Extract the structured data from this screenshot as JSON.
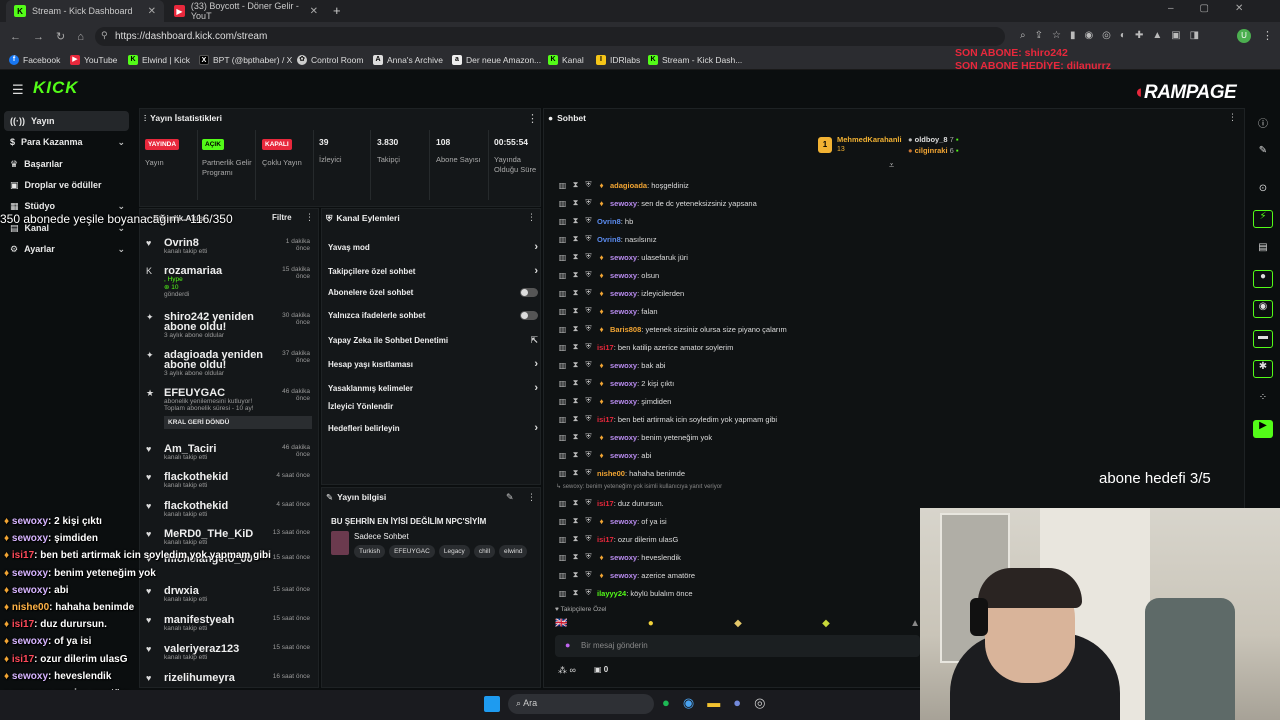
{
  "tabs": [
    {
      "title": "Stream - Kick Dashboard",
      "active": true
    },
    {
      "title": "(33) Boycott - Döner Gelir - YouT",
      "active": false
    }
  ],
  "browser": {
    "url": "https://dashboard.kick.com/stream"
  },
  "bookmarks": [
    "Facebook",
    "YouTube",
    "Elwind | Kick",
    "BPT (@bpthaber) / X",
    "Control Room",
    "Anna's Archive",
    "Der neue Amazon...",
    "Kanal",
    "IDRlabs",
    "Stream - Kick Dash..."
  ],
  "overlay": {
    "son_abone": "SON ABONE: shiro242",
    "son_abone_hediye": "SON ABONE HEDİYE: dilanurrz",
    "brand": "RAMPAGE",
    "sub_goal_text": "350 abonede yeşile boyanacağım - 116/350",
    "abone_hedefi": "abone hedefi 3/5"
  },
  "sidebar": {
    "logo": "KICK",
    "items": [
      {
        "label": "Yayın",
        "active": true
      },
      {
        "label": "Para Kazanma",
        "chevron": true
      },
      {
        "label": "Başarılar"
      },
      {
        "label": "Droplar ve ödüller"
      },
      {
        "label": "Stüdyo",
        "chevron": true
      },
      {
        "label": "Kanal",
        "chevron": true
      },
      {
        "label": "Ayarlar",
        "chevron": true
      }
    ]
  },
  "stats": {
    "title": "Yayın İstatistikleri",
    "badges": [
      {
        "badge": "YAYINDA",
        "label": "Yayın",
        "color": "#e8283c"
      },
      {
        "badge": "AÇIK",
        "label": "Partnerlik Gelir Programı",
        "color": "#53fc18"
      },
      {
        "badge": "KAPALI",
        "label": "Çoklu Yayın",
        "color": "#e8283c"
      }
    ],
    "numbers": [
      {
        "value": "39",
        "label": "İzleyici"
      },
      {
        "value": "3.830",
        "label": "Takipçi"
      },
      {
        "value": "108",
        "label": "Abone Sayısı"
      },
      {
        "value": "00:55:54",
        "label": "Yayında Olduğu Süre"
      }
    ]
  },
  "activity": {
    "title": "Etkinlik Akışı",
    "filter": "Filtre",
    "items": [
      {
        "name": "Ovrin8",
        "sub": "kanalı takip etti",
        "time": "1 dakika önce",
        "icon": "♥"
      },
      {
        "name": "rozamariaa",
        "sub": ", Hype",
        "sub2": "10",
        "sub3": "gönderdi",
        "time": "15 dakika önce",
        "icon": "K"
      },
      {
        "name": "shiro242 yeniden abone oldu!",
        "sub": "3 aylık abone oldular",
        "time": "30 dakika önce",
        "icon": "✦"
      },
      {
        "name": "adagioada yeniden abone oldu!",
        "sub": "3 aylık abone oldular",
        "time": "37 dakika önce",
        "icon": "✦"
      },
      {
        "name": "EFEUYGAC",
        "sub": "abonelik yenilemesini kutluyor! Toplam abonelik süresi - 10 ay!",
        "box": "KRAL GERİ DÖNDÜ",
        "time": "46 dakika önce",
        "icon": "★"
      },
      {
        "name": "Am_Taciri",
        "sub": "kanalı takip etti",
        "time": "46 dakika önce",
        "icon": "♥"
      },
      {
        "name": "flackothekid",
        "sub": "kanalı takip etti",
        "time": "4 saat önce",
        "icon": "♥"
      },
      {
        "name": "flackothekid",
        "sub": "kanalı takip etti",
        "time": "4 saat önce",
        "icon": "♥"
      },
      {
        "name": "MeRD0_THe_KiD",
        "sub": "kanalı takip etti",
        "time": "13 saat önce",
        "icon": "♥"
      },
      {
        "name": "michelangelo_00",
        "sub": "",
        "time": "15 saat önce",
        "icon": "♥"
      },
      {
        "name": "drwxia",
        "sub": "kanalı takip etti",
        "time": "15 saat önce",
        "icon": "♥"
      },
      {
        "name": "manifestyeah",
        "sub": "kanalı takip etti",
        "time": "15 saat önce",
        "icon": "♥"
      },
      {
        "name": "valeriyeraz123",
        "sub": "kanalı takip etti",
        "time": "15 saat önce",
        "icon": "♥"
      },
      {
        "name": "rizelihumeyra",
        "sub": "",
        "time": "16 saat önce",
        "icon": "♥"
      }
    ]
  },
  "channel_actions": {
    "title": "Kanal Eylemleri",
    "items": [
      {
        "label": "Yavaş mod",
        "ctrl": "arrow"
      },
      {
        "label": "Takipçilere özel sohbet",
        "ctrl": "arrow"
      },
      {
        "label": "Abonelere özel sohbet",
        "ctrl": "toggle"
      },
      {
        "label": "Yalnızca ifadelerle sohbet",
        "ctrl": "toggle"
      },
      {
        "label": "Yapay Zeka ile Sohbet Denetimi",
        "ctrl": "ext"
      },
      {
        "label": "Hesap yaşı kısıtlaması",
        "ctrl": "arrow"
      },
      {
        "label": "Yasaklanmış kelimeler",
        "ctrl": "arrow"
      },
      {
        "label": "İzleyici Yönlendir",
        "ctrl": "none"
      },
      {
        "label": "Hedefleri belirleyin",
        "ctrl": "arrow"
      }
    ]
  },
  "stream_info": {
    "title": "Yayın bilgisi",
    "stream_title": "BU ŞEHRİN EN İYİSİ DEĞİLİM NPC'SİYİM",
    "category": "Sadece Sohbet",
    "tags": [
      "Turkish",
      "EFEUYGAC",
      "Legacy",
      "chill",
      "elwind"
    ]
  },
  "chat": {
    "title": "Sohbet",
    "pinned": [
      {
        "name": "MehmedKarahanli",
        "count": "13"
      },
      {
        "name": "oldboy_8",
        "count": "7"
      },
      {
        "name": "cilginraki",
        "count": "6"
      }
    ],
    "messages": [
      {
        "user": "adagioada",
        "color": "#f2a533",
        "text": ": hoşgeldiniz"
      },
      {
        "user": "sewoxy",
        "color": "#b98cf0",
        "text": ": sen de dc yeteneksizsiniz yapsana"
      },
      {
        "user": "Ovrin8",
        "color": "#5b8cf0",
        "text": ": hb"
      },
      {
        "user": "Ovrin8",
        "color": "#5b8cf0",
        "text": ": nasılsınız"
      },
      {
        "user": "sewoxy",
        "color": "#b98cf0",
        "text": ": ulasefaruk jüri"
      },
      {
        "user": "sewoxy",
        "color": "#b98cf0",
        "text": ": olsun"
      },
      {
        "user": "sewoxy",
        "color": "#b98cf0",
        "text": ": izleyicilerden"
      },
      {
        "user": "sewoxy",
        "color": "#b98cf0",
        "text": ": falan"
      },
      {
        "user": "Baris808",
        "color": "#f2a533",
        "text": ": yetenek sizsiniz olursa size piyano çalarım"
      },
      {
        "user": "isi17",
        "color": "#e8283c",
        "text": ": ben katilip azerice amator soylerim"
      },
      {
        "user": "sewoxy",
        "color": "#b98cf0",
        "text": ": bak abi"
      },
      {
        "user": "sewoxy",
        "color": "#b98cf0",
        "text": ": 2 kişi çıktı"
      },
      {
        "user": "sewoxy",
        "color": "#b98cf0",
        "text": ": şimdiden"
      },
      {
        "user": "isi17",
        "color": "#e8283c",
        "text": ": ben beti artirmak icin soyledim yok yapmam gibi"
      },
      {
        "user": "sewoxy",
        "color": "#b98cf0",
        "text": ": benim yeteneğim yok"
      },
      {
        "user": "sewoxy",
        "color": "#b98cf0",
        "text": ": abi"
      },
      {
        "user": "nishe00",
        "color": "#f2a533",
        "text": ": hahaha benimde"
      },
      {
        "user": "isi17",
        "color": "#e8283c",
        "text": ": duz durursun.",
        "reply": "↳ sewoxy: benim yeteneğim yok isimli kullanıcıya yanıt veriyor"
      },
      {
        "user": "sewoxy",
        "color": "#b98cf0",
        "text": ": of ya isi"
      },
      {
        "user": "isi17",
        "color": "#e8283c",
        "text": ": ozur dilerim ulasG"
      },
      {
        "user": "sewoxy",
        "color": "#b98cf0",
        "text": ": heveslendik"
      },
      {
        "user": "sewoxy",
        "color": "#b98cf0",
        "text": ": azerice amatöre"
      },
      {
        "user": "ilayyy24",
        "color": "#53fc18",
        "text": ": köylü bulalım önce"
      }
    ],
    "mode": "Takipçilere Özel",
    "placeholder": "Bir mesaj gönderin",
    "viewers_icon": "∞",
    "count": "0"
  },
  "overlay_chat": [
    {
      "user": "sewoxy",
      "color": "#d6b4ff",
      "text": ": 2 kişi çıktı"
    },
    {
      "user": "sewoxy",
      "color": "#d6b4ff",
      "text": ": şimdiden"
    },
    {
      "user": "isi17",
      "color": "#ff4a5a",
      "text": ": ben beti artirmak icin soyledim yok yapmam gibi"
    },
    {
      "user": "sewoxy",
      "color": "#d6b4ff",
      "text": ": benim yeteneğim yok"
    },
    {
      "user": "sewoxy",
      "color": "#d6b4ff",
      "text": ": abi"
    },
    {
      "user": "nishe00",
      "color": "#ffb347",
      "text": ": hahaha benimde"
    },
    {
      "user": "isi17",
      "color": "#ff4a5a",
      "text": ": duz durursun."
    },
    {
      "user": "sewoxy",
      "color": "#d6b4ff",
      "text": ": of ya isi"
    },
    {
      "user": "isi17",
      "color": "#ff4a5a",
      "text": ": ozur dilerim ulasG"
    },
    {
      "user": "sewoxy",
      "color": "#d6b4ff",
      "text": ": heveslendik"
    },
    {
      "user": "sewoxy",
      "color": "#d6b4ff",
      "text": ": azerice amatöre"
    },
    {
      "user": "ilayyy24",
      "color": "#7dff5a",
      "text": ": köylü bulalım önce"
    }
  ],
  "taskbar": {
    "search": "Ara"
  },
  "colors": {
    "kick_green": "#53fc18",
    "live_red": "#e8283c",
    "panel": "#141719"
  }
}
